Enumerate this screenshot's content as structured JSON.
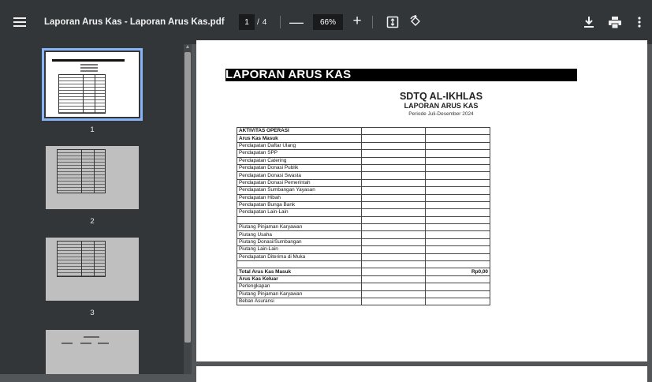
{
  "toolbar": {
    "title": "Laporan Arus Kas - Laporan Arus Kas.pdf",
    "current_page": "1",
    "page_separator": "/",
    "total_pages": "4",
    "zoom_out": "—",
    "zoom": "66%",
    "zoom_in": "+",
    "icons": [
      "menu-icon",
      "fit-to-page-icon",
      "rotate-icon",
      "download-icon",
      "print-icon",
      "more-options-icon"
    ]
  },
  "sidebar": {
    "thumbnails": [
      {
        "label": "1",
        "selected": true
      },
      {
        "label": "2",
        "selected": false
      },
      {
        "label": "3",
        "selected": false
      }
    ]
  },
  "document": {
    "title": "LAPORAN ARUS KAS",
    "school": "SDTQ AL-IKHLAS",
    "subtitle": "LAPORAN ARUS KAS",
    "period": "Periode Juli-Desember 2024",
    "rows": [
      {
        "label": "AKTIVITAS OPERASI",
        "bold": true,
        "value": ""
      },
      {
        "label": "Arus Kas Masuk",
        "bold": true,
        "value": ""
      },
      {
        "label": "Pendapatan Daftar Ulang",
        "bold": false,
        "value": ""
      },
      {
        "label": "Pendapatan SPP",
        "bold": false,
        "value": ""
      },
      {
        "label": "Pendapatan Catering",
        "bold": false,
        "value": ""
      },
      {
        "label": "Pendapatan Donasi Publik",
        "bold": false,
        "value": ""
      },
      {
        "label": "Pendapatan Donasi Swasta",
        "bold": false,
        "value": ""
      },
      {
        "label": "Pendapatan Donasi Pemerintah",
        "bold": false,
        "value": ""
      },
      {
        "label": "Pendapatan Sumbangan Yayasan",
        "bold": false,
        "value": ""
      },
      {
        "label": "Pendapatan Hibah",
        "bold": false,
        "value": ""
      },
      {
        "label": "Pendapatan Bunga Bank",
        "bold": false,
        "value": ""
      },
      {
        "label": "Pendapatan Lain-Lain",
        "bold": false,
        "value": ""
      },
      {
        "label": "",
        "bold": false,
        "value": ""
      },
      {
        "label": "Piutang Pinjaman Karyawan",
        "bold": false,
        "value": ""
      },
      {
        "label": "Piutang Usaha",
        "bold": false,
        "value": ""
      },
      {
        "label": "Piutang Donasi/Sumbangan",
        "bold": false,
        "value": ""
      },
      {
        "label": "Piutang Lain-Lain",
        "bold": false,
        "value": ""
      },
      {
        "label": "Pendapatan Diterima di Muka",
        "bold": false,
        "value": ""
      },
      {
        "label": "",
        "bold": false,
        "value": ""
      },
      {
        "label": "Total Arus Kas Masuk",
        "bold": true,
        "value": "Rp0,00"
      },
      {
        "label": "Arus Kas Keluar",
        "bold": true,
        "value": ""
      },
      {
        "label": "Perlengkapan",
        "bold": false,
        "value": ""
      },
      {
        "label": "Piutang Pinjaman Karyawan",
        "bold": false,
        "value": ""
      },
      {
        "label": "Beban Asuransi",
        "bold": false,
        "value": ""
      }
    ]
  }
}
